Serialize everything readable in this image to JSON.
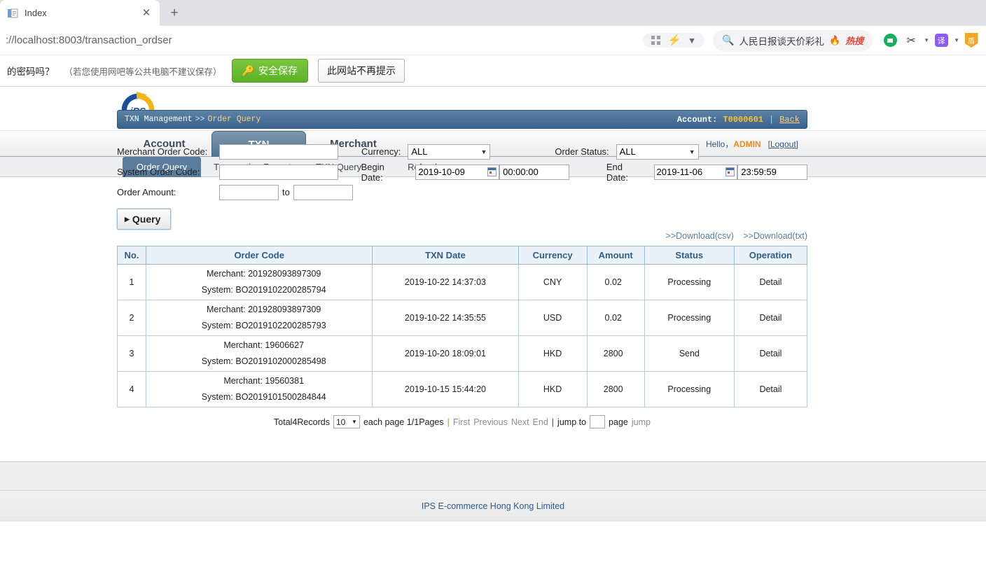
{
  "browser": {
    "tab": {
      "title": "Index",
      "favicon_icon": "document-icon",
      "close_icon": "close-icon"
    },
    "new_tab_icon": "plus-icon",
    "url_prefix": "://localhost",
    "url_bold": ":8003",
    "url_rest": "/transaction_ordser",
    "url_full": "://localhost:8003/transaction_ordser",
    "omni_icons": [
      "grid-icon",
      "bolt-icon",
      "chevron-down-icon"
    ],
    "search": {
      "search_icon": "search-icon",
      "text": "人民日报谈天价彩礼",
      "flame_icon": "flame-icon",
      "hot_label": "热搜"
    },
    "extensions": [
      {
        "name": "reader-extension-icon",
        "label": ""
      },
      {
        "name": "scissors-extension-icon",
        "label": "✂"
      },
      {
        "name": "translate-extension-icon",
        "label": "译"
      },
      {
        "name": "shield-extension-icon",
        "label": "盾"
      }
    ]
  },
  "password_bar": {
    "question": "的密码吗？",
    "note": "（若您使用网吧等公共电脑不建议保存）",
    "save_button": "安全保存",
    "save_icon": "key-icon",
    "never_button": "此网站不再提示"
  },
  "site": {
    "logo_alt": "iPS",
    "nav": [
      {
        "label": "Account",
        "active": false
      },
      {
        "label": "TXN",
        "active": true
      },
      {
        "label": "Merchant",
        "active": false
      }
    ],
    "user": {
      "hello": "Hello，",
      "name": "ADMIN",
      "logout": "[Logout]"
    },
    "subnav": [
      {
        "label": "Order Query",
        "active": true
      },
      {
        "label": "Transaction Report",
        "active": false
      },
      {
        "label": "TXN Query",
        "active": false
      },
      {
        "label": "Refund",
        "active": false
      }
    ],
    "breadcrumb": {
      "root": "TXN Management",
      "arrow": ">>",
      "current": "Order Query",
      "account_label": "Account:",
      "account_value": "T0000601",
      "separator": "|",
      "back": "Back"
    },
    "footer": "IPS E-commerce Hong Kong Limited"
  },
  "form": {
    "merchant_order_code": {
      "label": "Merchant Order Code:",
      "value": ""
    },
    "system_order_code": {
      "label": "System Order Code:",
      "value": ""
    },
    "order_amount": {
      "label": "Order Amount:",
      "from": "",
      "to_label": "to",
      "to": ""
    },
    "currency": {
      "label": "Currency:",
      "value": "ALL"
    },
    "begin_date": {
      "label": "Begin Date:",
      "date": "2019-10-09",
      "time": "00:00:00",
      "calendar_icon": "calendar-icon"
    },
    "order_status": {
      "label": "Order Status:",
      "value": "ALL"
    },
    "end_date": {
      "label": "End Date:",
      "date": "2019-11-06",
      "time": "23:59:59",
      "calendar_icon": "calendar-icon"
    },
    "query_button": "Query"
  },
  "downloads": {
    "csv": ">>Download(csv)",
    "txt": ">>Download(txt)"
  },
  "table": {
    "headers": [
      "No.",
      "Order Code",
      "TXN Date",
      "Currency",
      "Amount",
      "Status",
      "Operation"
    ],
    "merchant_label": "Merchant:",
    "system_label": "System:",
    "rows": [
      {
        "no": "1",
        "merchant": "201928093897309",
        "system": "BO2019102200285794",
        "date": "2019-10-22 14:37:03",
        "currency": "CNY",
        "amount": "0.02",
        "status": "Processing",
        "operation": "Detail"
      },
      {
        "no": "2",
        "merchant": "201928093897309",
        "system": "BO2019102200285793",
        "date": "2019-10-22 14:35:55",
        "currency": "USD",
        "amount": "0.02",
        "status": "Processing",
        "operation": "Detail"
      },
      {
        "no": "3",
        "merchant": "19606627",
        "system": "BO2019102000285498",
        "date": "2019-10-20 18:09:01",
        "currency": "HKD",
        "amount": "2800",
        "status": "Send",
        "operation": "Detail"
      },
      {
        "no": "4",
        "merchant": "19560381",
        "system": "BO2019101500284844",
        "date": "2019-10-15 15:44:20",
        "currency": "HKD",
        "amount": "2800",
        "status": "Processing",
        "operation": "Detail"
      }
    ]
  },
  "pager": {
    "total": "Total4Records",
    "page_size": "10",
    "each_page": "each page 1/1Pages",
    "sep1": "|",
    "first": "First",
    "previous": "Previous",
    "next": "Next",
    "end": "End",
    "sep2": "|",
    "jump_to": "jump to",
    "jump_value": "",
    "page_word": "page",
    "jump": "jump"
  },
  "colors": {
    "nav_active": "#4f7190",
    "crumb_bg": "#39628c",
    "accent_orange": "#f08a1e",
    "amount_orange": "#e8851a",
    "link_blue": "#5a7ea5",
    "save_green": "#5cb226"
  }
}
